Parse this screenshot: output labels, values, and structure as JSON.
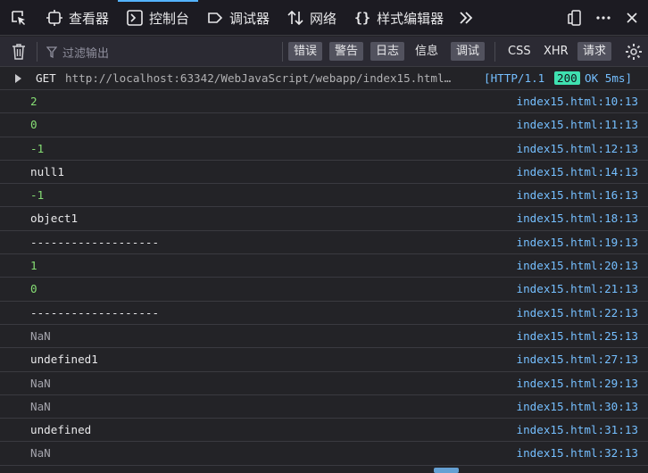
{
  "tabs": [
    {
      "label": "查看器",
      "icon": "inspector-icon"
    },
    {
      "label": "控制台",
      "icon": "console-icon",
      "active": true
    },
    {
      "label": "调试器",
      "icon": "debugger-icon"
    },
    {
      "label": "网络",
      "icon": "network-icon"
    },
    {
      "label": "样式编辑器",
      "icon": "style-editor-icon"
    }
  ],
  "toolbar": {
    "filter_placeholder": "过滤输出",
    "buttons": [
      {
        "label": "错误",
        "on": true
      },
      {
        "label": "警告",
        "on": true
      },
      {
        "label": "日志",
        "on": true
      },
      {
        "label": "信息",
        "on": false
      },
      {
        "label": "调试",
        "on": true
      },
      {
        "label": "CSS",
        "on": false
      },
      {
        "label": "XHR",
        "on": false
      },
      {
        "label": "请求",
        "on": true
      }
    ]
  },
  "request": {
    "method": "GET",
    "url": "http://localhost:63342/WebJavaScript/webapp/index15.html…",
    "protocol": "[HTTP/1.1",
    "status": "200",
    "status_text": "OK 5ms]"
  },
  "console": [
    {
      "value": "2",
      "type": "num",
      "source": "index15.html:10:13"
    },
    {
      "value": "0",
      "type": "num",
      "source": "index15.html:11:13"
    },
    {
      "value": "-1",
      "type": "num",
      "source": "index15.html:12:13"
    },
    {
      "value": "null1",
      "type": "str",
      "source": "index15.html:14:13"
    },
    {
      "value": "-1",
      "type": "num",
      "source": "index15.html:16:13"
    },
    {
      "value": "object1",
      "type": "str",
      "source": "index15.html:18:13"
    },
    {
      "value": "-------------------",
      "type": "str",
      "source": "index15.html:19:13"
    },
    {
      "value": "1",
      "type": "num",
      "source": "index15.html:20:13"
    },
    {
      "value": "0",
      "type": "num",
      "source": "index15.html:21:13"
    },
    {
      "value": "-------------------",
      "type": "str",
      "source": "index15.html:22:13"
    },
    {
      "value": "NaN",
      "type": "dim",
      "source": "index15.html:25:13"
    },
    {
      "value": "undefined1",
      "type": "str",
      "source": "index15.html:27:13"
    },
    {
      "value": "NaN",
      "type": "dim",
      "source": "index15.html:29:13"
    },
    {
      "value": "NaN",
      "type": "dim",
      "source": "index15.html:30:13"
    },
    {
      "value": "undefined",
      "type": "str",
      "source": "index15.html:31:13"
    },
    {
      "value": "NaN",
      "type": "dim",
      "source": "index15.html:32:13"
    }
  ]
}
